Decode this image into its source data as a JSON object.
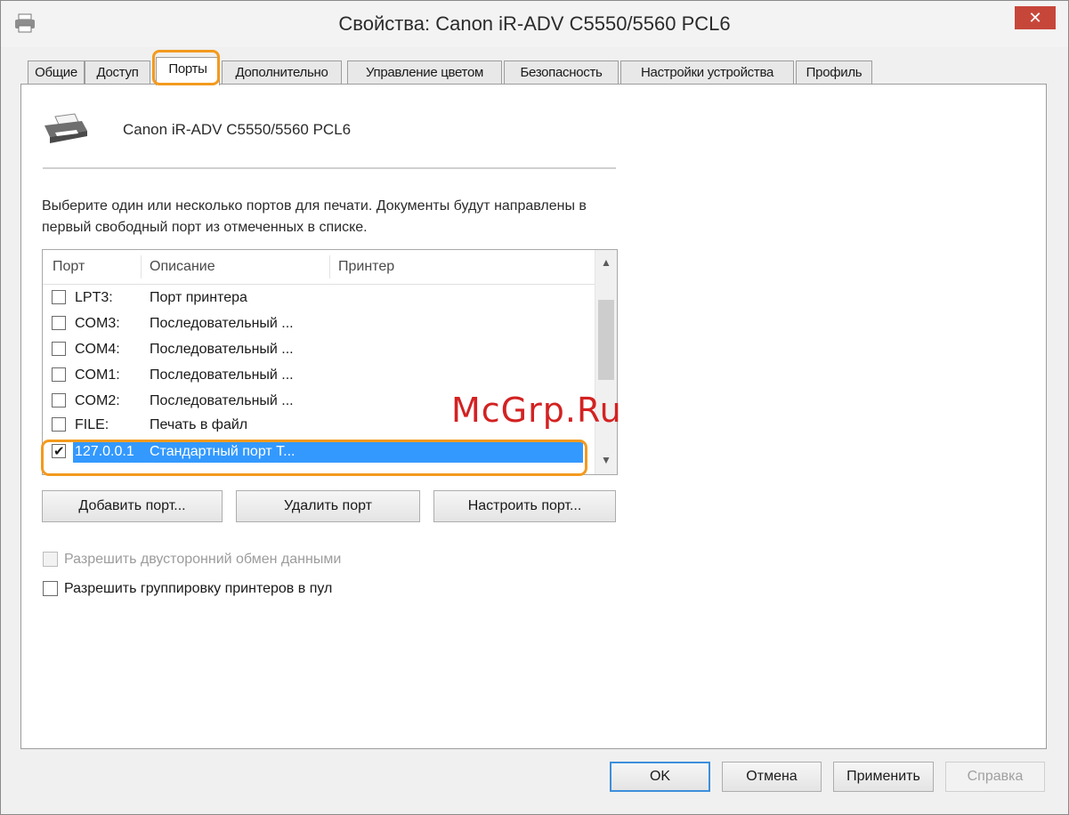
{
  "window": {
    "title": "Свойства: Canon iR-ADV C5550/5560 PCL6",
    "close_icon": "close-icon",
    "close_glyph": "✕"
  },
  "tabs": [
    {
      "label": "Общие"
    },
    {
      "label": "Доступ"
    },
    {
      "label": "Порты",
      "active": true
    },
    {
      "label": "Дополнительно"
    },
    {
      "label": "Управление цветом"
    },
    {
      "label": "Безопасность"
    },
    {
      "label": "Настройки устройства"
    },
    {
      "label": "Профиль"
    }
  ],
  "printer": {
    "name": "Canon iR-ADV C5550/5560 PCL6",
    "icon": "printer-icon"
  },
  "instructions": "Выберите один или несколько портов для печати. Документы будут направлены в первый свободный порт из отмеченных в списке.",
  "port_list": {
    "columns": [
      "Порт",
      "Описание",
      "Принтер"
    ],
    "rows": [
      {
        "port": "LPT3:",
        "description": "Порт принтера",
        "checked": false
      },
      {
        "port": "COM3:",
        "description": "Последовательный ...",
        "checked": false
      },
      {
        "port": "COM4:",
        "description": "Последовательный ...",
        "checked": false
      },
      {
        "port": "COM1:",
        "description": "Последовательный ...",
        "checked": false
      },
      {
        "port": "COM2:",
        "description": "Последовательный ...",
        "checked": false
      },
      {
        "port": "FILE:",
        "description": "Печать в файл",
        "checked": false
      },
      {
        "port": "127.0.0.1",
        "description": "Стандартный порт Т...",
        "checked": true,
        "selected": true
      }
    ]
  },
  "port_buttons": {
    "add": "Добавить порт...",
    "delete": "Удалить порт",
    "configure": "Настроить порт..."
  },
  "options": {
    "bidirectional": {
      "label": "Разрешить двусторонний обмен данными",
      "enabled": false
    },
    "pooling": {
      "label": "Разрешить группировку принтеров в пул",
      "enabled": true
    }
  },
  "dialog_buttons": {
    "ok": "OK",
    "cancel": "Отмена",
    "apply": "Применить",
    "help": "Справка"
  },
  "watermark": "McGrp.Ru",
  "colors": {
    "highlight": "#f39a1e",
    "selection": "#3399ff",
    "close": "#c7463a"
  }
}
